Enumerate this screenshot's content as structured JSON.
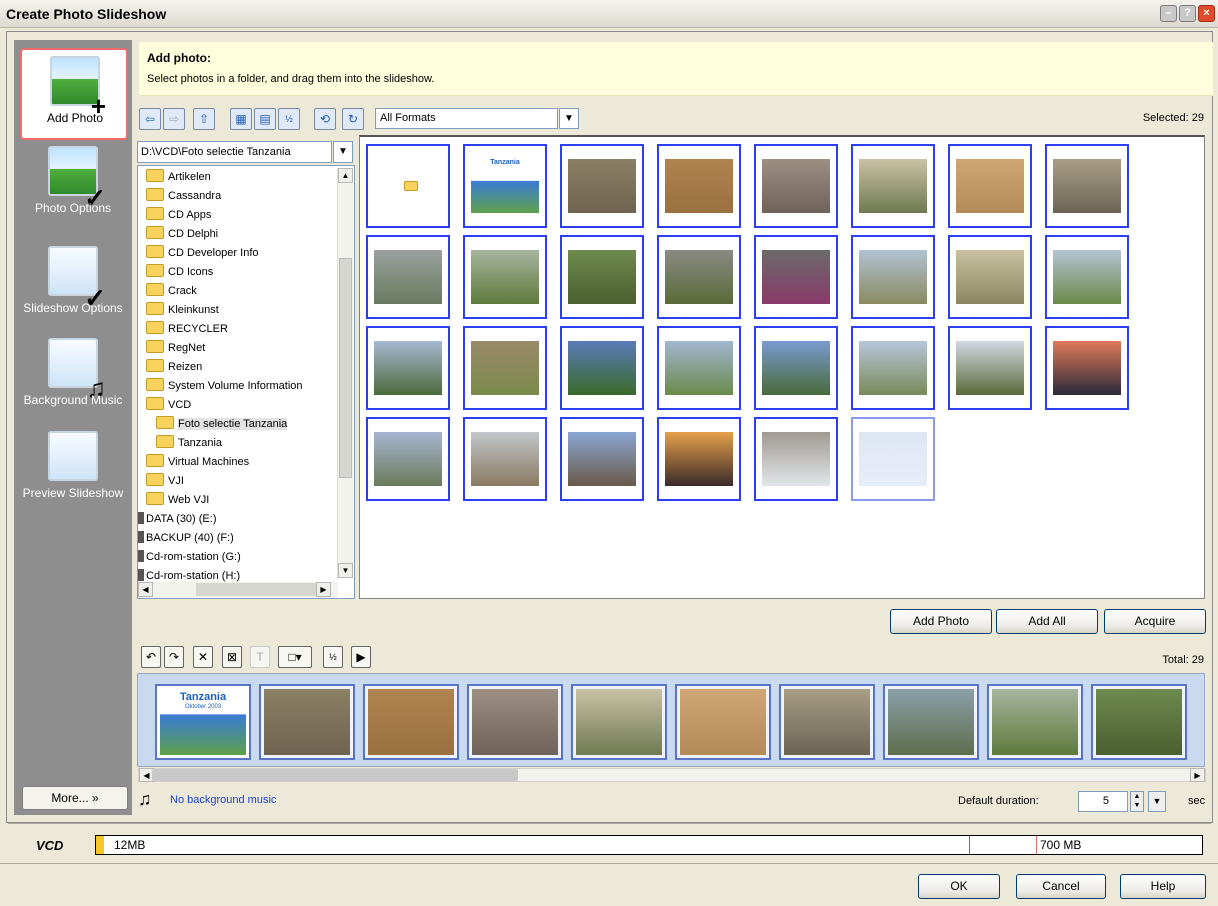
{
  "window": {
    "title": "Create Photo Slideshow"
  },
  "sidebar": {
    "items": [
      {
        "label": "Add Photo",
        "icon": "add-photo-icon",
        "active": true
      },
      {
        "label": "Photo Options",
        "icon": "photo-options-icon"
      },
      {
        "label": "Slideshow Options",
        "icon": "slideshow-options-icon"
      },
      {
        "label": "Background Music",
        "icon": "background-music-icon"
      },
      {
        "label": "Preview Slideshow",
        "icon": "preview-slideshow-icon"
      }
    ],
    "more_label": "More..."
  },
  "header": {
    "title": "Add photo:",
    "subtitle": "Select photos in a folder, and drag them into the slideshow."
  },
  "toolbar": {
    "format_value": "All Formats",
    "selected_text": "Selected: 29"
  },
  "tree": {
    "path": "D:\\VCD\\Foto selectie Tanzania",
    "items": [
      {
        "label": "Artikelen",
        "type": "folder"
      },
      {
        "label": "Cassandra",
        "type": "folder"
      },
      {
        "label": "CD Apps",
        "type": "folder"
      },
      {
        "label": "CD Delphi",
        "type": "folder"
      },
      {
        "label": "CD Developer Info",
        "type": "folder"
      },
      {
        "label": "CD Icons",
        "type": "folder"
      },
      {
        "label": "Crack",
        "type": "folder"
      },
      {
        "label": "Kleinkunst",
        "type": "folder"
      },
      {
        "label": "RECYCLER",
        "type": "folder"
      },
      {
        "label": "RegNet",
        "type": "folder"
      },
      {
        "label": "Reizen",
        "type": "folder"
      },
      {
        "label": "System Volume Information",
        "type": "folder"
      },
      {
        "label": "VCD",
        "type": "folder"
      },
      {
        "label": "Foto selectie Tanzania",
        "type": "folder",
        "child": true,
        "selected": true
      },
      {
        "label": "Tanzania",
        "type": "folder",
        "child": true
      },
      {
        "label": "Virtual Machines",
        "type": "folder"
      },
      {
        "label": "VJI",
        "type": "folder"
      },
      {
        "label": "Web VJI",
        "type": "folder"
      },
      {
        "label": "DATA (30) (E:)",
        "type": "drive"
      },
      {
        "label": "BACKUP (40) (F:)",
        "type": "drive"
      },
      {
        "label": "Cd-rom-station (G:)",
        "type": "drive"
      },
      {
        "label": "Cd-rom-station (H:)",
        "type": "drive"
      }
    ]
  },
  "grid": {
    "thumbs": [
      {
        "kind": "folder"
      },
      {
        "kind": "title",
        "top": "#3a7bd5",
        "bottom": "#5fa04a",
        "caption": "Tanzania"
      },
      {
        "kind": "photo",
        "top": "#8a8064",
        "bottom": "#6f6450"
      },
      {
        "kind": "photo",
        "top": "#b08450",
        "bottom": "#9a7040"
      },
      {
        "kind": "photo",
        "top": "#9c8f82",
        "bottom": "#6e625a"
      },
      {
        "kind": "photo",
        "top": "#c9c2a6",
        "bottom": "#6f7a52"
      },
      {
        "kind": "photo",
        "top": "#cfa674",
        "bottom": "#b48a58"
      },
      {
        "kind": "photo",
        "top": "#a89e86",
        "bottom": "#6c6454"
      },
      {
        "kind": "photo",
        "top": "#9aa0a0",
        "bottom": "#6a7a5e"
      },
      {
        "kind": "photo",
        "top": "#a7b59e",
        "bottom": "#5e7a3c"
      },
      {
        "kind": "photo",
        "top": "#6e8a4e",
        "bottom": "#4a6030"
      },
      {
        "kind": "photo",
        "top": "#8a8a82",
        "bottom": "#5a6a3a"
      },
      {
        "kind": "photo",
        "top": "#6a6a6a",
        "bottom": "#8a3a6a"
      },
      {
        "kind": "photo",
        "top": "#b2c2d2",
        "bottom": "#8a8a62"
      },
      {
        "kind": "photo",
        "top": "#c8c2a2",
        "bottom": "#8a8662"
      },
      {
        "kind": "photo",
        "top": "#b4c4d2",
        "bottom": "#6a8a4a"
      },
      {
        "kind": "photo",
        "top": "#a6b8d2",
        "bottom": "#4a6a3a"
      },
      {
        "kind": "photo",
        "top": "#9a8a6a",
        "bottom": "#7a8a4a"
      },
      {
        "kind": "photo",
        "top": "#5a7ab8",
        "bottom": "#3a6a2a"
      },
      {
        "kind": "photo",
        "top": "#a2b6d2",
        "bottom": "#6a8a4a"
      },
      {
        "kind": "photo",
        "top": "#7a9ad2",
        "bottom": "#4a6a3a"
      },
      {
        "kind": "photo",
        "top": "#b6c6da",
        "bottom": "#7a8a5a"
      },
      {
        "kind": "photo",
        "top": "#d2d8e2",
        "bottom": "#5a6a3a"
      },
      {
        "kind": "photo",
        "top": "#e07a5a",
        "bottom": "#2a2a3a"
      },
      {
        "kind": "photo",
        "top": "#a6b6d2",
        "bottom": "#6a7a5a"
      },
      {
        "kind": "photo",
        "top": "#c2c6ca",
        "bottom": "#8a7a62"
      },
      {
        "kind": "photo",
        "top": "#8aa6d2",
        "bottom": "#6a5a4a"
      },
      {
        "kind": "photo",
        "top": "#e6a04a",
        "bottom": "#3a2a2a"
      },
      {
        "kind": "photo",
        "top": "#a09a92",
        "bottom": "#e2e6ea"
      },
      {
        "kind": "faded",
        "top": "#dfe6f4",
        "bottom": "#e8eef8"
      }
    ]
  },
  "buttons": {
    "add_photo": "Add Photo",
    "add_all": "Add All",
    "acquire": "Acquire",
    "ok": "OK",
    "cancel": "Cancel",
    "help": "Help"
  },
  "strip": {
    "total_text": "Total: 29",
    "thumbs": [
      {
        "kind": "title",
        "top": "#3a7bd5",
        "bottom": "#5fa04a",
        "caption": "Tanzania",
        "sub": "Oktober 2003"
      },
      {
        "kind": "photo",
        "top": "#8a8064",
        "bottom": "#6f6450"
      },
      {
        "kind": "photo",
        "top": "#b08450",
        "bottom": "#9a7040"
      },
      {
        "kind": "photo",
        "top": "#9c8f82",
        "bottom": "#6e625a"
      },
      {
        "kind": "photo",
        "top": "#c9c2a6",
        "bottom": "#6f7a52"
      },
      {
        "kind": "photo",
        "top": "#cfa674",
        "bottom": "#b48a58"
      },
      {
        "kind": "photo",
        "top": "#a89e86",
        "bottom": "#6c6454"
      },
      {
        "kind": "photo",
        "top": "#8aa0a8",
        "bottom": "#5e6e4e"
      },
      {
        "kind": "photo",
        "top": "#a7b59e",
        "bottom": "#5e7a3c"
      },
      {
        "kind": "photo",
        "top": "#6e8a4e",
        "bottom": "#4a6030"
      }
    ]
  },
  "music": {
    "text": "No background music",
    "icon": "music-note-icon"
  },
  "duration": {
    "label": "Default duration:",
    "value": "5",
    "unit": "sec"
  },
  "capacity": {
    "disc": "VCD",
    "used": "12MB",
    "max": "700 MB",
    "used_fraction": 0.017
  }
}
